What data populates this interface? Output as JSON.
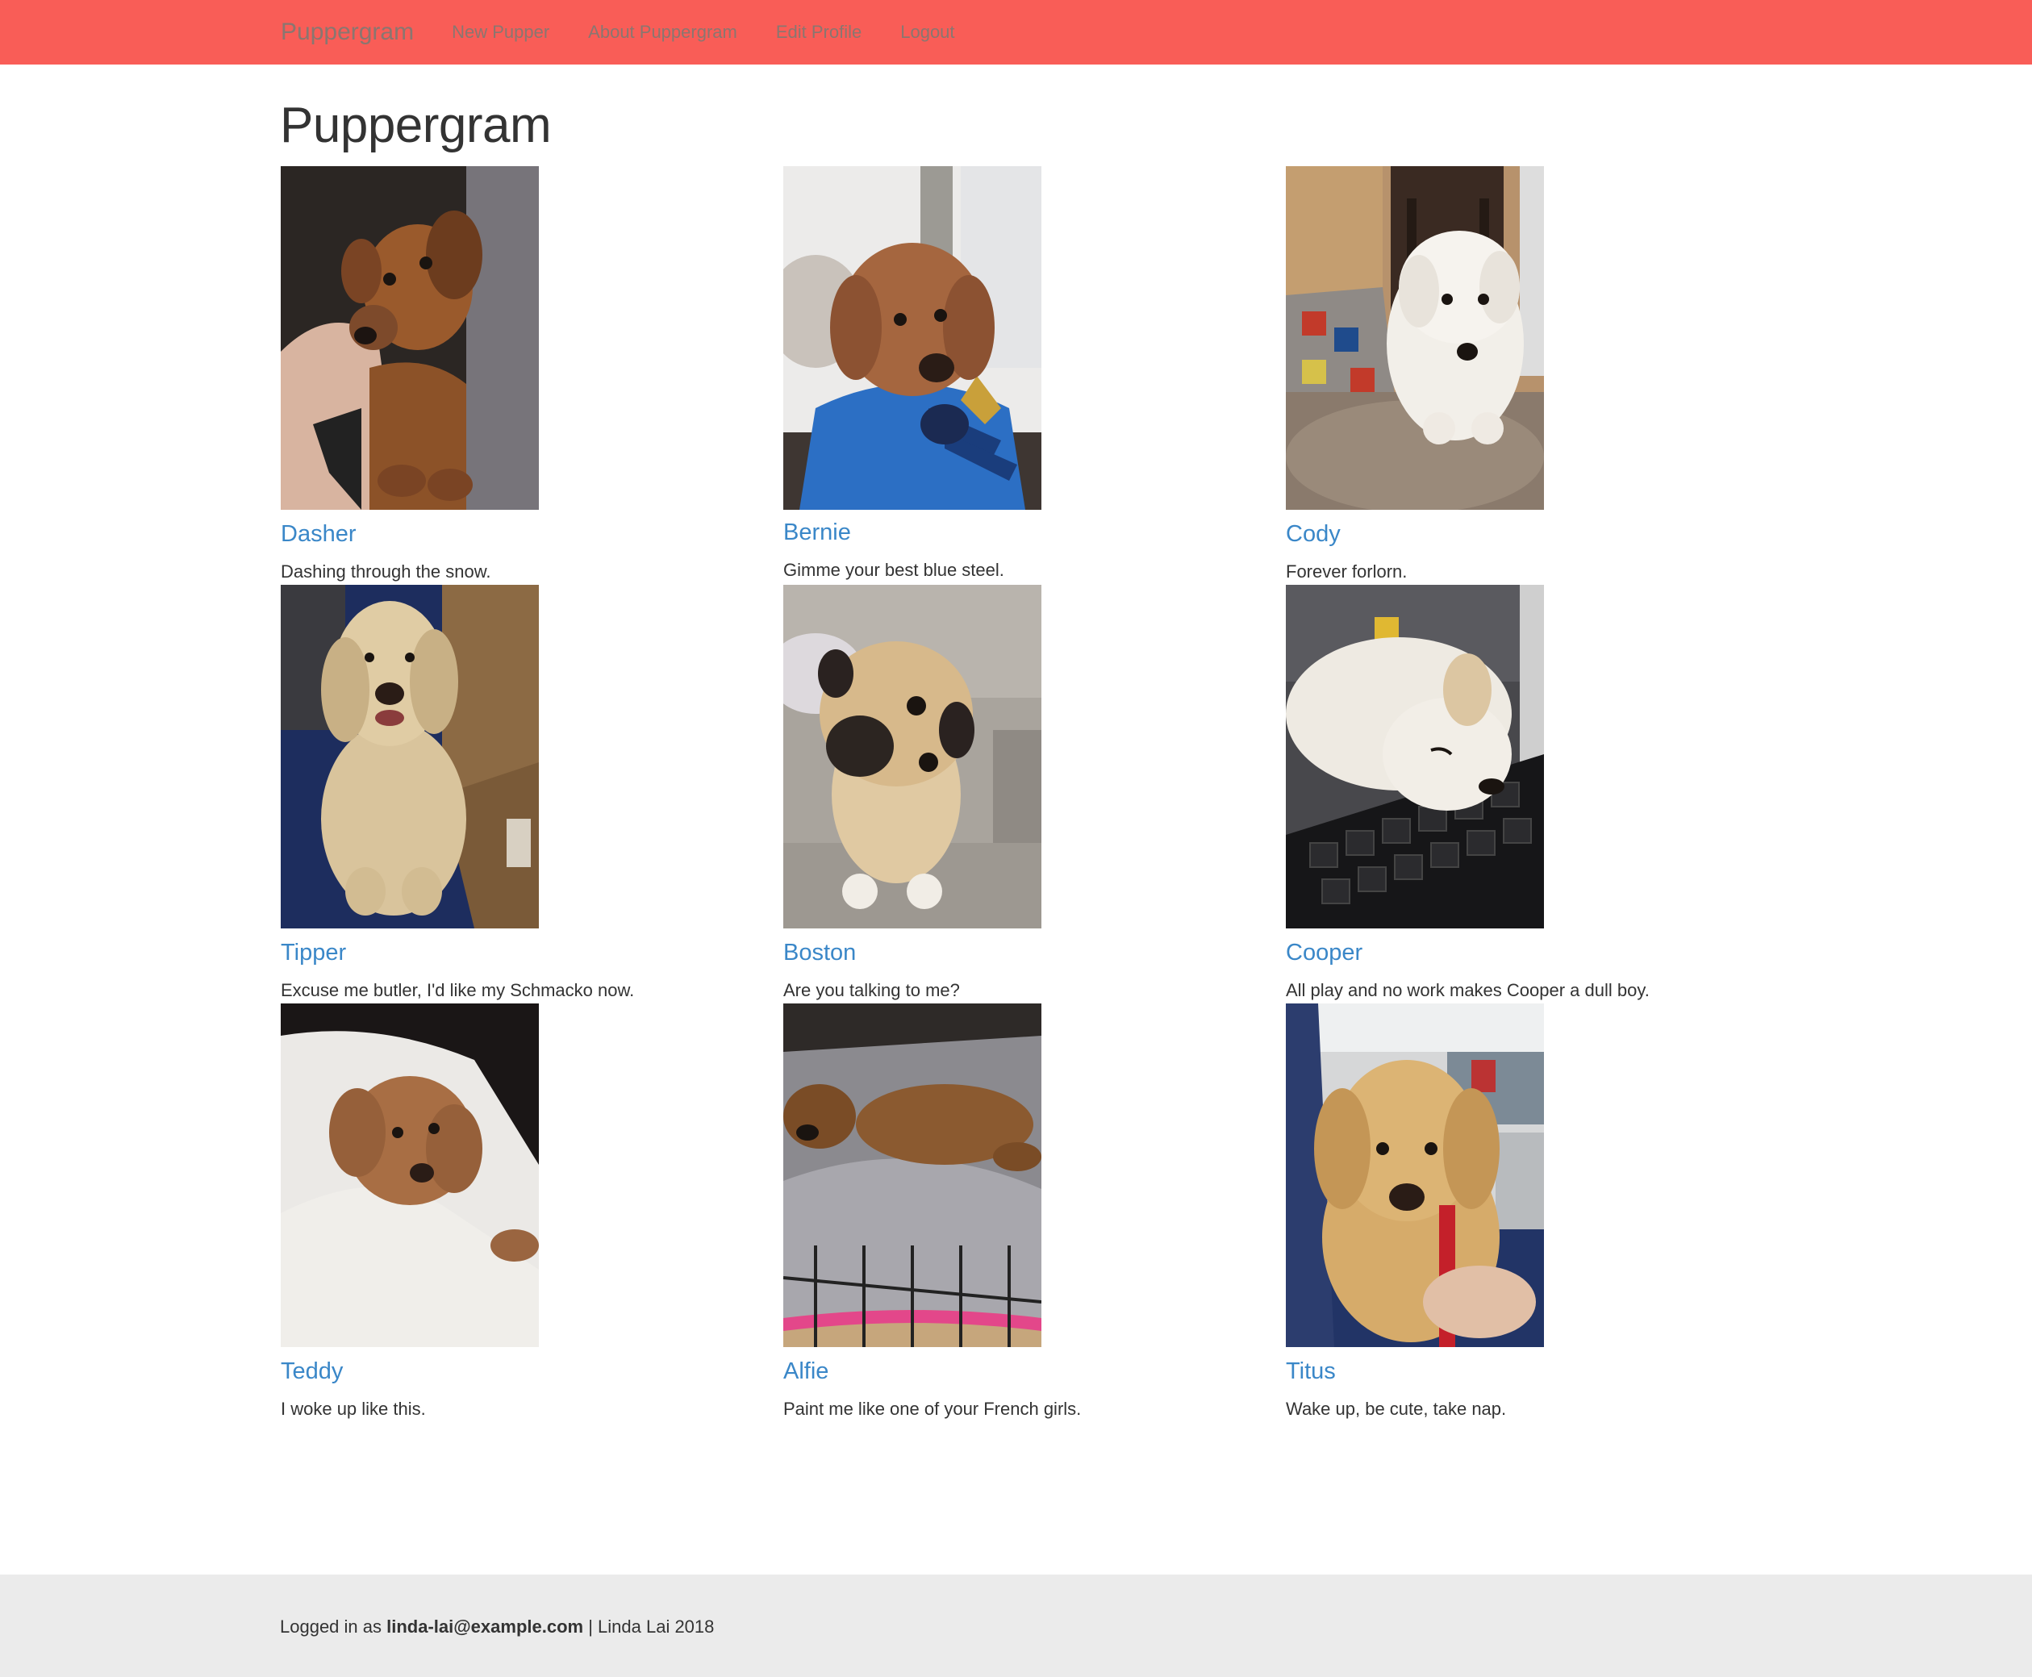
{
  "navbar": {
    "brand": "Puppergram",
    "links": [
      "New Pupper",
      "About Puppergram",
      "Edit Profile",
      "Logout"
    ]
  },
  "page_title": "Puppergram",
  "colors": {
    "navbar_bg": "#f95d57",
    "nav_text": "#8a7670",
    "link_blue": "#3a87c8",
    "footer_bg": "#ebebeb"
  },
  "puppers": [
    {
      "name": "Dasher",
      "caption": "Dashing through the snow."
    },
    {
      "name": "Bernie",
      "caption": "Gimme your best blue steel."
    },
    {
      "name": "Cody",
      "caption": "Forever forlorn."
    },
    {
      "name": "Tipper",
      "caption": "Excuse me butler, I'd like my Schmacko now."
    },
    {
      "name": "Boston",
      "caption": "Are you talking to me?"
    },
    {
      "name": "Cooper",
      "caption": "All play and no work makes Cooper a dull boy."
    },
    {
      "name": "Teddy",
      "caption": "I woke up like this."
    },
    {
      "name": "Alfie",
      "caption": "Paint me like one of your French girls."
    },
    {
      "name": "Titus",
      "caption": "Wake up, be cute, take nap."
    }
  ],
  "footer": {
    "prefix": "Logged in as ",
    "email": "linda-lai@example.com",
    "suffix": " | Linda Lai 2018"
  }
}
